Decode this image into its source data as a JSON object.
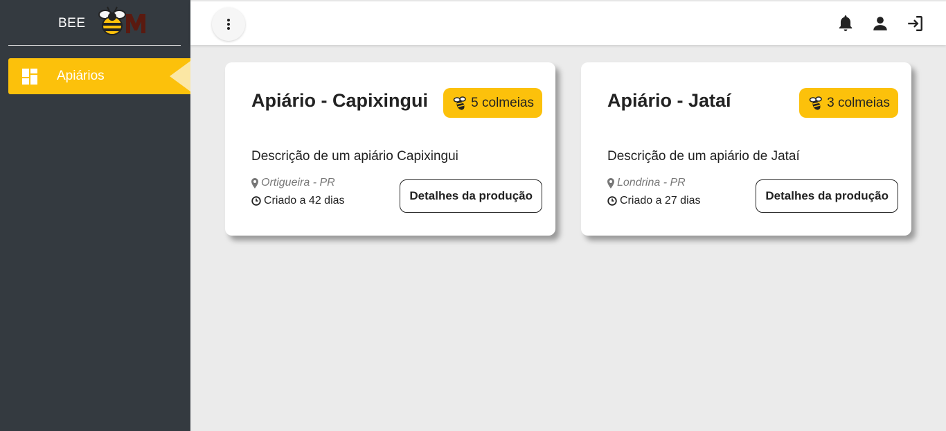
{
  "brand": {
    "text": "BEE",
    "logo": "bee-m-logo"
  },
  "sidebar": {
    "items": [
      {
        "label": "Apiários",
        "icon": "dashboard-icon",
        "active": true
      }
    ]
  },
  "header": {
    "menu_icon": "vertical-dots-icon",
    "icons": [
      "bell-icon",
      "user-icon",
      "logout-icon"
    ]
  },
  "apiaries": [
    {
      "title": "Apiário - Capixingui",
      "hives": "5 colmeias",
      "description": "Descrição de um apiário Capixingui",
      "location": "Ortigueira - PR",
      "created": "Criado a 42 dias",
      "button": "Detalhes da produção"
    },
    {
      "title": "Apiário - Jataí",
      "hives": "3 colmeias",
      "description": "Descrição de um apiário de Jataí",
      "location": "Londrina - PR",
      "created": "Criado a 27 dias",
      "button": "Detalhes da produção"
    }
  ],
  "colors": {
    "sidebar_bg": "#343a40",
    "accent": "#fcc10b",
    "page_bg": "#ebebeb"
  }
}
